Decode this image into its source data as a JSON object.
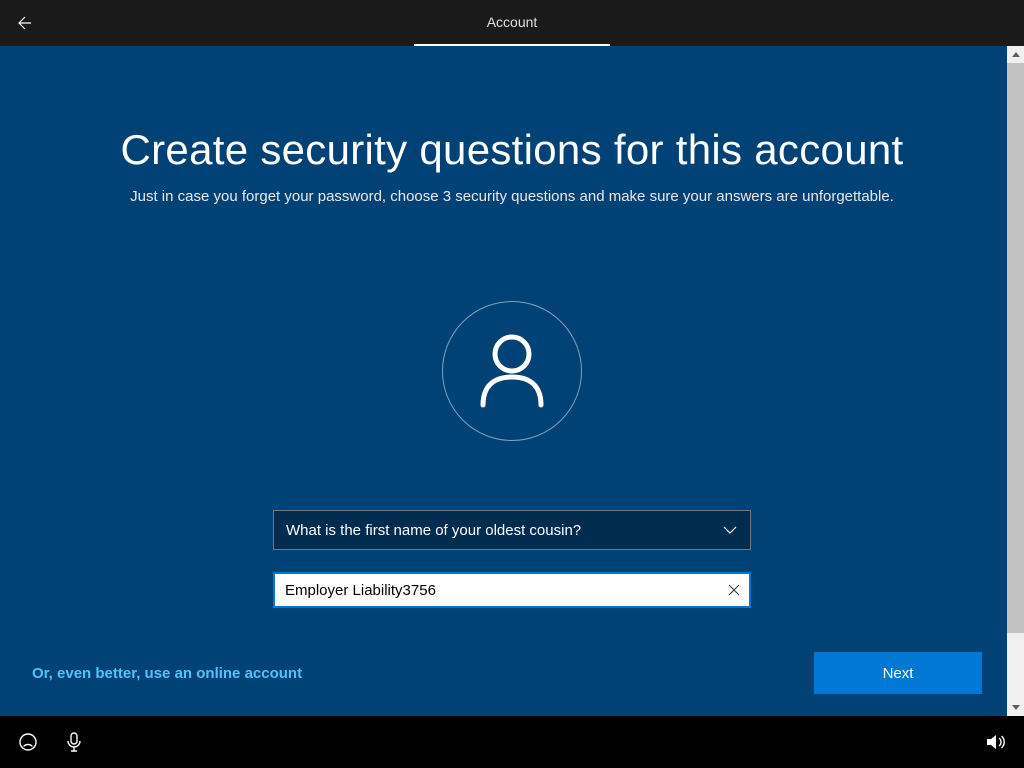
{
  "titlebar": {
    "tab_label": "Account"
  },
  "page": {
    "heading": "Create security questions for this account",
    "subheading": "Just in case you forget your password, choose 3 security questions and make sure your answers are unforgettable."
  },
  "form": {
    "question_selected": "What is the first name of your oldest cousin?",
    "answer_value": "Employer Liability3756"
  },
  "footer": {
    "online_link": "Or, even better, use an online account",
    "next_label": "Next"
  }
}
